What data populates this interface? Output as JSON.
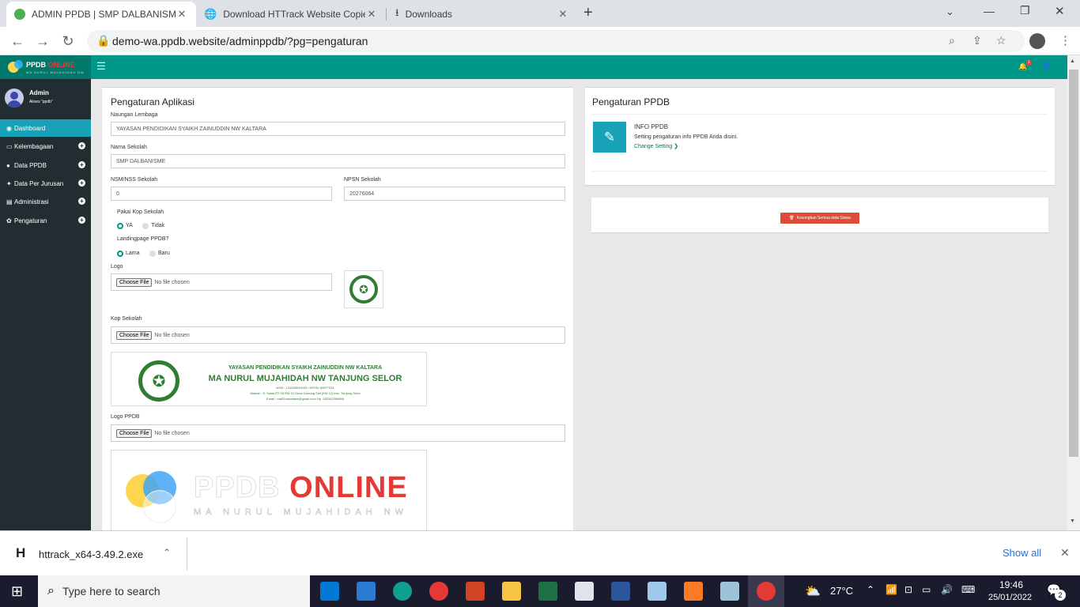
{
  "browser": {
    "tabs": [
      {
        "title": "ADMIN PPDB | SMP DALBANISME"
      },
      {
        "title": "Download HTTrack Website Copier"
      },
      {
        "title": "Downloads"
      }
    ],
    "new_tab": "+",
    "url": "demo-wa.ppdb.website/adminppdb/?pg=pengaturan"
  },
  "app": {
    "brand_main": "PPDB",
    "brand_accent": "ONLINE",
    "brand_sub": "MA NURUL MUJAHIDAH NW",
    "menu_icon": "☰",
    "notif_count": "1",
    "user": {
      "name": "Admin",
      "sub": "Akses \"ppdb\""
    },
    "sidebar": [
      {
        "label": "Dashboard",
        "icon": "◉",
        "active": true
      },
      {
        "label": "Kelembagaan",
        "icon": "▭",
        "active": false
      },
      {
        "label": "Data PPDB",
        "icon": "●",
        "active": false
      },
      {
        "label": "Data Per Jurusan",
        "icon": "✦",
        "active": false
      },
      {
        "label": "Administrasi",
        "icon": "▤",
        "active": false
      },
      {
        "label": "Pengaturan",
        "icon": "✿",
        "active": false
      }
    ]
  },
  "settings": {
    "title": "Pengaturan Aplikasi",
    "naungan_label": "Naungan Lembaga",
    "naungan_value": "YAYASAN PENDIDIKAN SYAIKH ZAINUDDIN NW KALTARA",
    "nama_label": "Nama Sekolah",
    "nama_value": "SMP DALBANISME",
    "nsm_label": "NSM/NSS Sekolah",
    "nsm_value": "0",
    "npsn_label": "NPSN Sekolah",
    "npsn_value": "20276064",
    "kop_q": "Pakai Kop Sekolah",
    "kop_yes": "YA",
    "kop_no": "Tidak",
    "landing_q": "Landingpage PPDB?",
    "landing_old": "Lama",
    "landing_new": "Baru",
    "logo_label": "Logo",
    "kop_label": "Kop Sekolah",
    "logo_ppdb_label": "Logo PPDB",
    "file_button": "Choose File",
    "file_none": "No file chosen",
    "kop_banner": {
      "line1": "YAYASAN PENDIDIKAN SYAIKH ZAINUDDIN NW KALTARA",
      "line2": "MA NURUL MUJAHIDAH NW TANJUNG SELOR",
      "line3": "NSM : 131265040003 / NPSN: 69977331",
      "line4": "Alamat : Jl. Salak RT 06 RW 01 Desa Gunung Seli (KM 12) Kec. Tanjung Selor",
      "line5": "Email : ma02nwkaltara@gmail.com  Hp. 082342398666"
    },
    "ppdb_logo_main": "PPDB",
    "ppdb_logo_accent": "ONLINE",
    "ppdb_logo_sub": "MA NURUL MUJAHIDAH NW"
  },
  "ppdb_panel": {
    "title": "Pengaturan PPDB",
    "info_title": "INFO PPDB",
    "info_desc": "Setting pengaturan info PPDB Anda disini.",
    "info_link": "Change Setting ❯",
    "empty_button": "Kosongkan Semua data Siswa"
  },
  "download": {
    "file": "httrack_x64-3.49.2.exe",
    "show_all": "Show all"
  },
  "taskbar": {
    "search": "Type here to search",
    "temp": "27°C",
    "time": "19:46",
    "date": "25/01/2022",
    "notif": "2"
  },
  "colors": {
    "teal": "#009688",
    "teal_dark": "#00796b",
    "sidebar": "#222d32",
    "red": "#dd4b39",
    "info": "#17a2b8"
  }
}
